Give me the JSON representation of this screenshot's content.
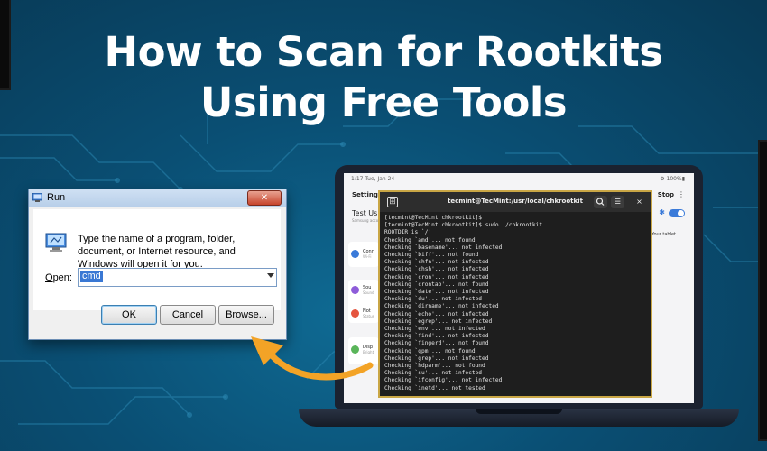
{
  "headline": {
    "line1": "How to Scan for Rootkits",
    "line2": "Using Free Tools"
  },
  "colors": {
    "background": "#0a4f74",
    "accent_orange": "#f3a326",
    "terminal_border": "#c9a645",
    "selection_blue": "#3a78d4"
  },
  "run_dialog": {
    "title": "Run",
    "close_icon": "close-icon",
    "description": "Type the name of a program, folder, document, or Internet resource, and Windows will open it for you.",
    "open_label_u": "O",
    "open_label_rest": "pen:",
    "input_value": "cmd",
    "buttons": {
      "ok": "OK",
      "cancel": "Cancel",
      "browse": "Browse..."
    }
  },
  "tablet": {
    "status_time": "1:17  Tue, Jan 24",
    "status_right": "⚙ 100%▮",
    "settings_title": "Settings",
    "stop_label": "Stop",
    "more_icon": "⋮",
    "test_label": "Test Us",
    "test_sub": "Samsung account",
    "tablet_label": "Your tablet",
    "rows": [
      {
        "label": "Conn",
        "sub": "Wi-Fi"
      },
      {
        "label": "Sou",
        "sub": "Sound"
      },
      {
        "label": "Not",
        "sub": "Status"
      },
      {
        "label": "Disp",
        "sub": "Bright"
      }
    ]
  },
  "terminal": {
    "title": "tecmint@TecMint:/usr/local/chkrootkit",
    "newtab_icon": "⊞",
    "search_icon": "🔍",
    "menu_icon": "☰",
    "close_icon": "×",
    "lines": [
      "[tecmint@TecMint chkrootkit]$",
      "[tecmint@TecMint chkrootkit]$ sudo ./chkrootkit",
      "ROOTDIR is `/'",
      "Checking `amd'... not found",
      "Checking `basename'... not infected",
      "Checking `biff'... not found",
      "Checking `chfn'... not infected",
      "Checking `chsh'... not infected",
      "Checking `cron'... not infected",
      "Checking `crontab'... not found",
      "Checking `date'... not infected",
      "Checking `du'... not infected",
      "Checking `dirname'... not infected",
      "Checking `echo'... not infected",
      "Checking `egrep'... not infected",
      "Checking `env'... not infected",
      "Checking `find'... not infected",
      "Checking `fingerd'... not found",
      "Checking `gpm'... not found",
      "Checking `grep'... not infected",
      "Checking `hdparm'... not found",
      "Checking `su'... not infected",
      "Checking `ifconfig'... not infected",
      "Checking `inetd'... not tested"
    ]
  }
}
